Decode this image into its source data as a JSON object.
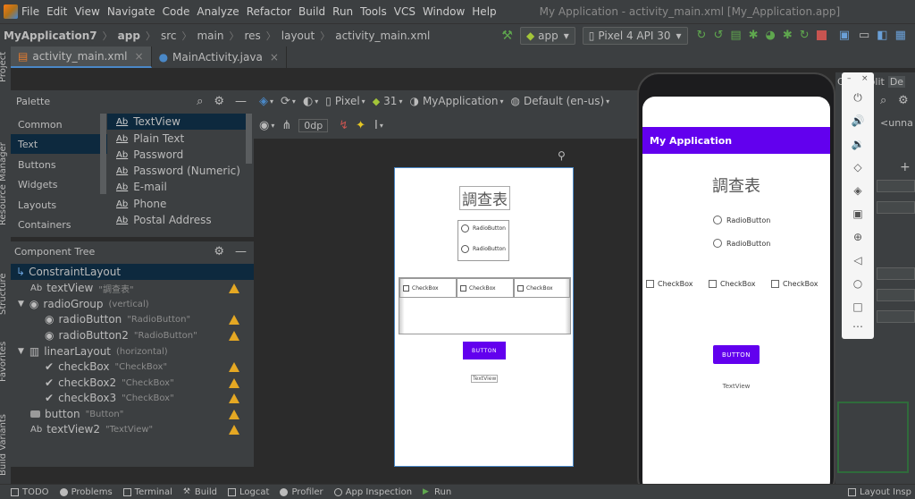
{
  "menubar": {
    "items": [
      "File",
      "Edit",
      "View",
      "Navigate",
      "Code",
      "Analyze",
      "Refactor",
      "Build",
      "Run",
      "Tools",
      "VCS",
      "Window",
      "Help"
    ],
    "window_title": "My Application - activity_main.xml [My_Application.app]"
  },
  "navbar": {
    "breadcrumbs": [
      "MyApplication7",
      "app",
      "src",
      "main",
      "res",
      "layout",
      "activity_main.xml"
    ],
    "run_config": "app",
    "device": "Pixel 4 API 30"
  },
  "tabs": [
    {
      "label": "activity_main.xml",
      "active": true
    },
    {
      "label": "MainActivity.java",
      "active": false
    }
  ],
  "leftstrip": [
    "Project",
    "Resource Manager",
    "Structure",
    "Favorites",
    "Build Variants"
  ],
  "palette": {
    "title": "Palette",
    "categories": [
      "Common",
      "Text",
      "Buttons",
      "Widgets",
      "Layouts",
      "Containers"
    ],
    "selected_category": "Text",
    "items": [
      {
        "icon": "Ab",
        "label": "TextView"
      },
      {
        "icon": "Ab",
        "label": "Plain Text"
      },
      {
        "icon": "Ab",
        "label": "Password"
      },
      {
        "icon": "Ab",
        "label": "Password (Numeric)"
      },
      {
        "icon": "Ab",
        "label": "E-mail"
      },
      {
        "icon": "Ab",
        "label": "Phone"
      },
      {
        "icon": "Ab",
        "label": "Postal Address"
      }
    ]
  },
  "design_toolbar": {
    "device": "Pixel",
    "api": "31",
    "theme": "MyApplication",
    "locale": "Default (en-us)",
    "margin": "0dp"
  },
  "component_tree": {
    "title": "Component Tree",
    "rows": [
      {
        "label": "ConstraintLayout",
        "sub": "",
        "indent": 0,
        "selected": true,
        "warn": false,
        "icon": "constraint-icon"
      },
      {
        "label": "textView",
        "sub": "\"調查表\"",
        "indent": 1,
        "selected": false,
        "warn": true,
        "icon": "Ab"
      },
      {
        "label": "radioGroup",
        "sub": "(vertical)",
        "indent": 1,
        "selected": false,
        "warn": false,
        "icon": "radio-group-icon"
      },
      {
        "label": "radioButton",
        "sub": "\"RadioButton\"",
        "indent": 2,
        "selected": false,
        "warn": true,
        "icon": "radio-icon"
      },
      {
        "label": "radioButton2",
        "sub": "\"RadioButton\"",
        "indent": 2,
        "selected": false,
        "warn": true,
        "icon": "radio-icon"
      },
      {
        "label": "linearLayout",
        "sub": "(horizontal)",
        "indent": 1,
        "selected": false,
        "warn": false,
        "icon": "linear-layout-icon"
      },
      {
        "label": "checkBox",
        "sub": "\"CheckBox\"",
        "indent": 2,
        "selected": false,
        "warn": true,
        "icon": "check-icon"
      },
      {
        "label": "checkBox2",
        "sub": "\"CheckBox\"",
        "indent": 2,
        "selected": false,
        "warn": true,
        "icon": "check-icon"
      },
      {
        "label": "checkBox3",
        "sub": "\"CheckBox\"",
        "indent": 2,
        "selected": false,
        "warn": true,
        "icon": "check-icon"
      },
      {
        "label": "button",
        "sub": "\"Button\"",
        "indent": 1,
        "selected": false,
        "warn": true,
        "icon": "button-icon"
      },
      {
        "label": "textView2",
        "sub": "\"TextView\"",
        "indent": 1,
        "selected": false,
        "warn": true,
        "icon": "Ab"
      }
    ]
  },
  "preview": {
    "title": "調查表",
    "radio1": "RadioButton",
    "radio2": "RadioButton",
    "check1": "CheckBox",
    "check2": "CheckBox",
    "check3": "CheckBox",
    "button": "BUTTON",
    "textview": "TextView"
  },
  "emulator": {
    "app_title": "My Application",
    "heading": "調查表",
    "radio1": "RadioButton",
    "radio2": "RadioButton",
    "check1": "CheckBox",
    "check2": "CheckBox",
    "check3": "CheckBox",
    "button": "BUTTON",
    "textview": "TextView",
    "accent": "#6200ee"
  },
  "rightpanel": {
    "tab1": "Cod",
    "tab2": "plit",
    "tab3": "De",
    "field": "<unna"
  },
  "bottombar": {
    "items": [
      "TODO",
      "Problems",
      "Terminal",
      "Build",
      "Logcat",
      "Profiler",
      "App Inspection",
      "Run",
      "Layout Insp"
    ]
  }
}
